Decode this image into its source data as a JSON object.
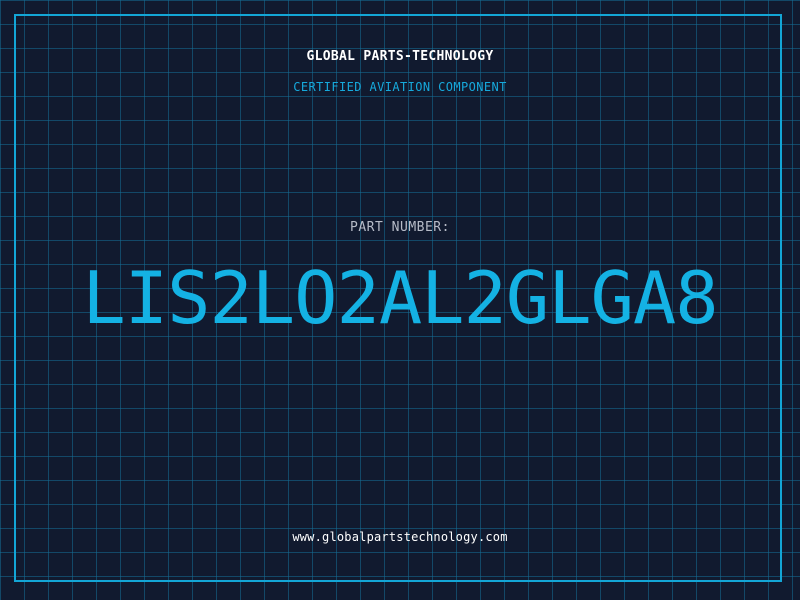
{
  "header": {
    "company": "GLOBAL PARTS-TECHNOLOGY",
    "subtitle": "CERTIFIED AVIATION COMPONENT"
  },
  "part": {
    "label": "PART NUMBER:",
    "number": "LIS2LO2AL2GLGA8"
  },
  "footer": {
    "website": "www.globalpartstechnology.com"
  },
  "colors": {
    "background": "#111a2f",
    "grid": "#146e96",
    "accent": "#14b2e4",
    "frame": "#13a6d6",
    "text_primary": "#ffffff",
    "text_muted": "#b7bcc8"
  }
}
